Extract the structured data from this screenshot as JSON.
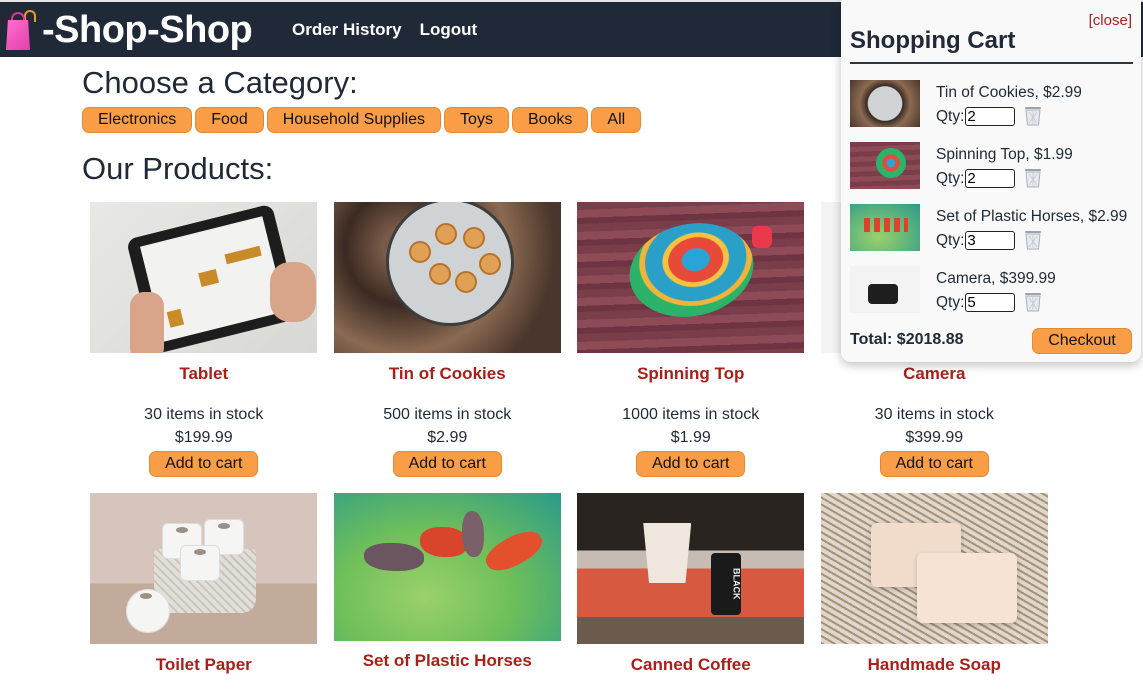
{
  "header": {
    "brand": "-Shop-Shop",
    "brand_icon": "shopping-bags-icon",
    "nav": [
      {
        "label": "Order History"
      },
      {
        "label": "Logout"
      }
    ]
  },
  "categories": {
    "title": "Choose a Category:",
    "items": [
      {
        "label": "Electronics"
      },
      {
        "label": "Food"
      },
      {
        "label": "Household Supplies"
      },
      {
        "label": "Toys"
      },
      {
        "label": "Books"
      },
      {
        "label": "All"
      }
    ]
  },
  "products": {
    "title": "Our Products:",
    "add_label": "Add to cart",
    "items": [
      {
        "name": "Tablet",
        "stock": "30 items in stock",
        "price": "$199.99"
      },
      {
        "name": "Tin of Cookies",
        "stock": "500 items in stock",
        "price": "$2.99"
      },
      {
        "name": "Spinning Top",
        "stock": "1000 items in stock",
        "price": "$1.99"
      },
      {
        "name": "Camera",
        "stock": "30 items in stock",
        "price": "$399.99"
      },
      {
        "name": "Toilet Paper"
      },
      {
        "name": "Set of Plastic Horses"
      },
      {
        "name": "Canned Coffee"
      },
      {
        "name": "Handmade Soap"
      }
    ]
  },
  "cart": {
    "close_label": "[close]",
    "title": "Shopping Cart",
    "qty_label": "Qty:",
    "items": [
      {
        "label": "Tin of Cookies, $2.99",
        "qty": "2"
      },
      {
        "label": "Spinning Top, $1.99",
        "qty": "2"
      },
      {
        "label": "Set of Plastic Horses, $2.99",
        "qty": "3"
      },
      {
        "label": "Camera, $399.99",
        "qty": "5"
      }
    ],
    "total": "Total: $2018.88",
    "checkout_label": "Checkout"
  },
  "colors": {
    "header_bg": "#1f2937",
    "accent_orange": "#f99d47",
    "product_name_red": "#a8201a"
  }
}
